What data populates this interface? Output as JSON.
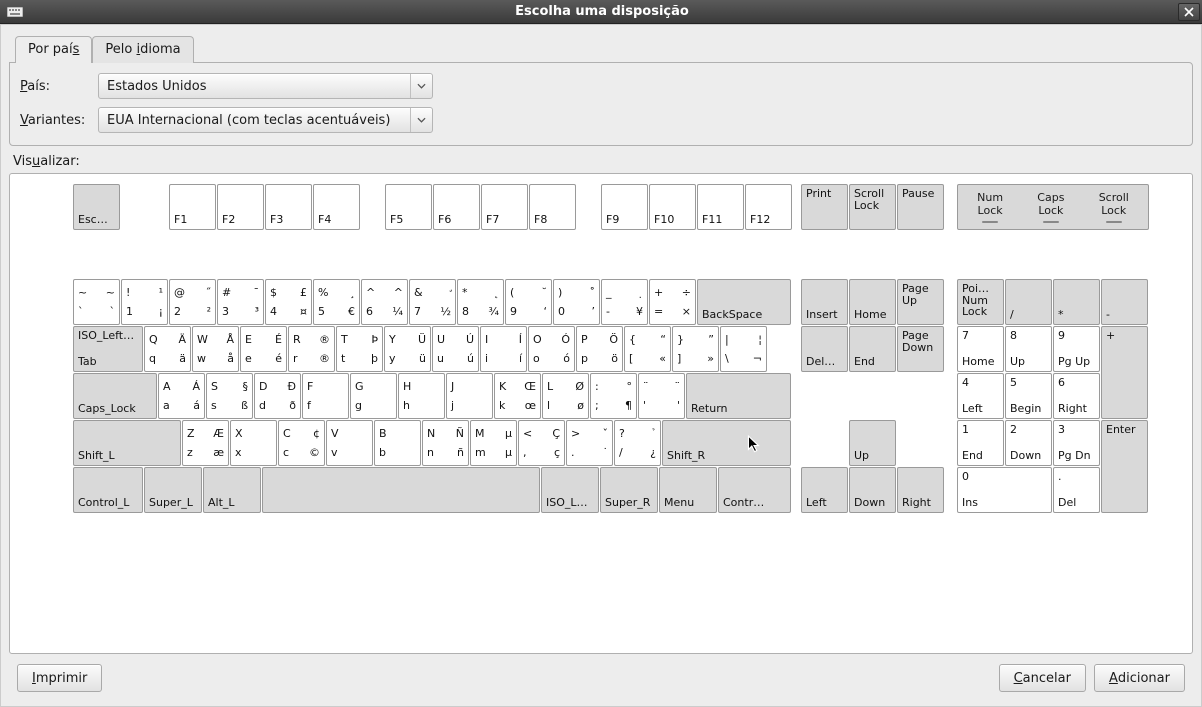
{
  "window": {
    "title": "Escolha uma disposição"
  },
  "tabs": {
    "country": "Por paí",
    "country_ul": "s",
    "language_pre": "Pelo ",
    "language_ul": "i",
    "language_post": "dioma"
  },
  "form": {
    "country_label_pre": "",
    "country_label_ul": "P",
    "country_label_post": "aís:",
    "country_value": "Estados Unidos",
    "variant_label_pre": "",
    "variant_label_ul": "V",
    "variant_label_post": "ariantes:",
    "variant_value": "EUA Internacional (com teclas acentuáveis)"
  },
  "preview_label_pre": "Vis",
  "preview_label_ul": "u",
  "preview_label_post": "alizar:",
  "buttons": {
    "print_pre": "",
    "print_ul": "I",
    "print_post": "mprimir",
    "cancel_pre": "",
    "cancel_ul": "C",
    "cancel_post": "ancelar",
    "add_pre": "",
    "add_ul": "A",
    "add_post": "dicionar"
  },
  "locks": {
    "num": "Num\nLock",
    "caps": "Caps\nLock",
    "scroll": "Scroll\nLock"
  },
  "keys": {
    "esc": "Esc…",
    "f1": "F1",
    "f2": "F2",
    "f3": "F3",
    "f4": "F4",
    "f5": "F5",
    "f6": "F6",
    "f7": "F7",
    "f8": "F8",
    "f9": "F9",
    "f10": "F10",
    "f11": "F11",
    "f12": "F12",
    "print": "Print",
    "scrlk": "Scroll\nLock",
    "pause": "Pause",
    "bksp": "BackSpace",
    "tab_top": "ISO_Left…",
    "tab_bot": "Tab",
    "caps": "Caps_Lock",
    "return": "Return",
    "lshift": "Shift_L",
    "rshift": "Shift_R",
    "lctrl": "Control_L",
    "lsuper": "Super_L",
    "lalt": "Alt_L",
    "isol": "ISO_L…",
    "rsuper": "Super_R",
    "menu": "Menu",
    "rctrl": "Contr…",
    "ins": "Insert",
    "home": "Home",
    "pgup": "Page\nUp",
    "del": "Del…",
    "end": "End",
    "pgdn": "Page\nDown",
    "up": "Up",
    "left": "Left",
    "down": "Down",
    "right": "Right",
    "np_lock_top": "Poi…\nNum\nLock",
    "np_div": "/",
    "np_mul": "*",
    "np_sub": "-",
    "np_add": "+",
    "np_enter": "Enter",
    "np7_top": "7",
    "np7_bot": "Home",
    "np8_top": "8",
    "np8_bot": "Up",
    "np9_top": "9",
    "np9_bot": "Pg Up",
    "np4_top": "4",
    "np4_bot": "Left",
    "np5_top": "5",
    "np5_bot": "Begin",
    "np6_top": "6",
    "np6_bot": "Right",
    "np1_top": "1",
    "np1_bot": "End",
    "np2_top": "2",
    "np2_bot": "Down",
    "np3_top": "3",
    "np3_bot": "Pg Dn",
    "np0_top": "0",
    "np0_bot": "Ins",
    "npd_top": ".",
    "npd_bot": "Del",
    "r1": [
      {
        "tl": "~",
        "tr": "~",
        "bl": "`",
        "br": "`"
      },
      {
        "tl": "!",
        "tr": "¹",
        "bl": "1",
        "br": "¡"
      },
      {
        "tl": "@",
        "tr": "˝",
        "bl": "2",
        "br": "²"
      },
      {
        "tl": "#",
        "tr": "¯",
        "bl": "3",
        "br": "³"
      },
      {
        "tl": "$",
        "tr": "£",
        "bl": "4",
        "br": "¤"
      },
      {
        "tl": "%",
        "tr": "¸",
        "bl": "5",
        "br": "€"
      },
      {
        "tl": "^",
        "tr": "^",
        "bl": "6",
        "br": "¼"
      },
      {
        "tl": "&",
        "tr": "̛",
        "bl": "7",
        "br": "½"
      },
      {
        "tl": "*",
        "tr": "˛",
        "bl": "8",
        "br": "¾"
      },
      {
        "tl": "(",
        "tr": "˘",
        "bl": "9",
        "br": "‘"
      },
      {
        "tl": ")",
        "tr": "̊",
        "bl": "0",
        "br": "’"
      },
      {
        "tl": "_",
        "tr": "̣",
        "bl": "-",
        "br": "¥"
      },
      {
        "tl": "+",
        "tr": "÷",
        "bl": "=",
        "br": "×"
      }
    ],
    "r2": [
      {
        "tl": "Q",
        "tr": "Ä",
        "bl": "q",
        "br": "ä"
      },
      {
        "tl": "W",
        "tr": "Å",
        "bl": "w",
        "br": "å"
      },
      {
        "tl": "E",
        "tr": "É",
        "bl": "e",
        "br": "é"
      },
      {
        "tl": "R",
        "tr": "®",
        "bl": "r",
        "br": "®"
      },
      {
        "tl": "T",
        "tr": "Þ",
        "bl": "t",
        "br": "þ"
      },
      {
        "tl": "Y",
        "tr": "Ü",
        "bl": "y",
        "br": "ü"
      },
      {
        "tl": "U",
        "tr": "Ú",
        "bl": "u",
        "br": "ú"
      },
      {
        "tl": "I",
        "tr": "Í",
        "bl": "i",
        "br": "í"
      },
      {
        "tl": "O",
        "tr": "Ó",
        "bl": "o",
        "br": "ó"
      },
      {
        "tl": "P",
        "tr": "Ö",
        "bl": "p",
        "br": "ö"
      },
      {
        "tl": "{",
        "tr": "“",
        "bl": "[",
        "br": "«"
      },
      {
        "tl": "}",
        "tr": "”",
        "bl": "]",
        "br": "»"
      },
      {
        "tl": "|",
        "tr": "¦",
        "bl": "\\",
        "br": "¬"
      }
    ],
    "r3": [
      {
        "tl": "A",
        "tr": "Á",
        "bl": "a",
        "br": "á"
      },
      {
        "tl": "S",
        "tr": "§",
        "bl": "s",
        "br": "ß"
      },
      {
        "tl": "D",
        "tr": "Ð",
        "bl": "d",
        "br": "ð"
      },
      {
        "tl": "F",
        "tr": "",
        "bl": "f",
        "br": ""
      },
      {
        "tl": "G",
        "tr": "",
        "bl": "g",
        "br": ""
      },
      {
        "tl": "H",
        "tr": "",
        "bl": "h",
        "br": ""
      },
      {
        "tl": "J",
        "tr": "",
        "bl": "j",
        "br": ""
      },
      {
        "tl": "K",
        "tr": "Œ",
        "bl": "k",
        "br": "œ"
      },
      {
        "tl": "L",
        "tr": "Ø",
        "bl": "l",
        "br": "ø"
      },
      {
        "tl": ":",
        "tr": "°",
        "bl": ";",
        "br": "¶"
      },
      {
        "tl": "¨",
        "tr": "¨",
        "bl": "'",
        "br": "'"
      }
    ],
    "r4": [
      {
        "tl": "Z",
        "tr": "Æ",
        "bl": "z",
        "br": "æ"
      },
      {
        "tl": "X",
        "tr": "",
        "bl": "x",
        "br": ""
      },
      {
        "tl": "C",
        "tr": "¢",
        "bl": "c",
        "br": "©"
      },
      {
        "tl": "V",
        "tr": "",
        "bl": "v",
        "br": ""
      },
      {
        "tl": "B",
        "tr": "",
        "bl": "b",
        "br": ""
      },
      {
        "tl": "N",
        "tr": "Ñ",
        "bl": "n",
        "br": "ñ"
      },
      {
        "tl": "M",
        "tr": "µ",
        "bl": "m",
        "br": "µ"
      },
      {
        "tl": "<",
        "tr": "Ç",
        "bl": ",",
        "br": "ç"
      },
      {
        "tl": ">",
        "tr": "ˇ",
        "bl": ".",
        "br": "˙"
      },
      {
        "tl": "?",
        "tr": "̉",
        "bl": "/",
        "br": "¿"
      }
    ]
  }
}
